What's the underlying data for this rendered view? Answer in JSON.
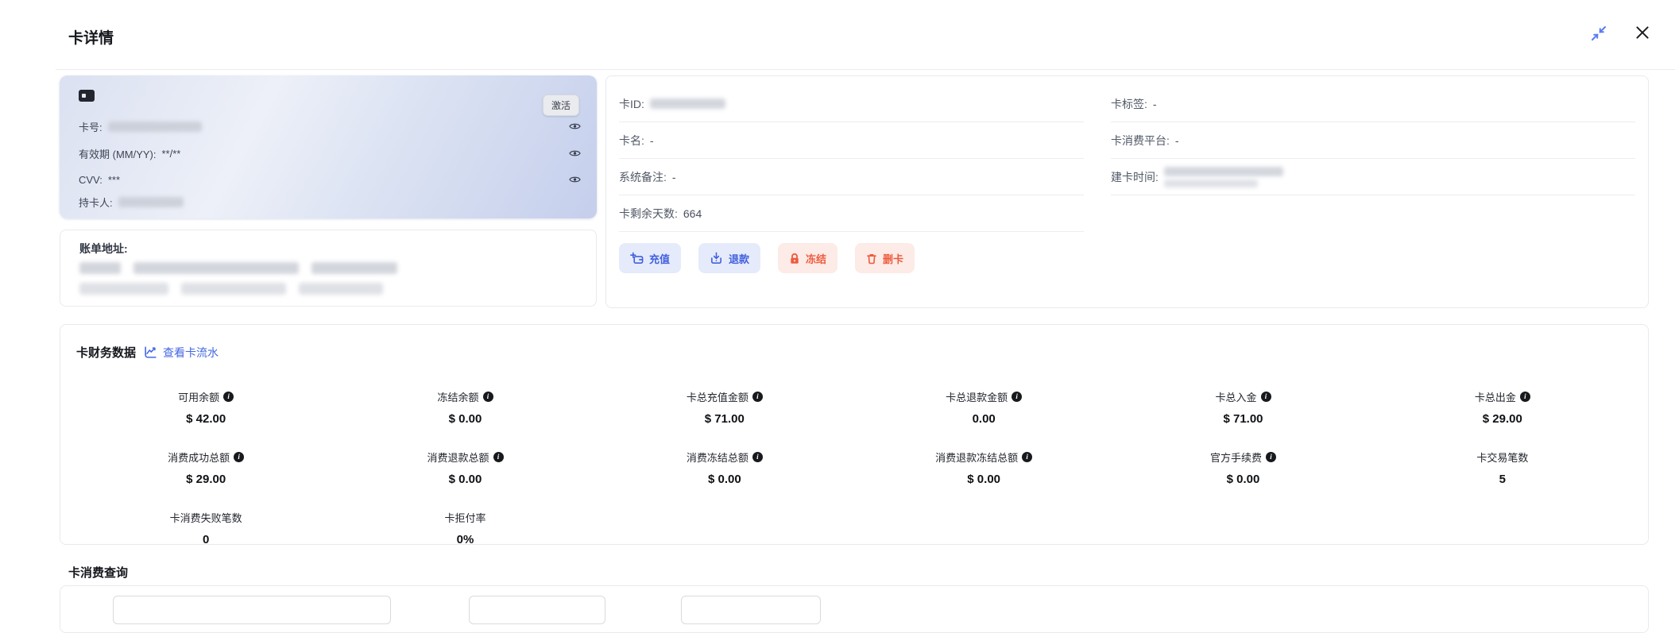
{
  "header": {
    "title": "卡详情"
  },
  "card": {
    "status_badge": "激活",
    "rows": [
      {
        "label": "卡号:",
        "masked": true
      },
      {
        "label": "有效期 (MM/YY):",
        "value": "**/**"
      },
      {
        "label": "CVV:",
        "value": "***"
      },
      {
        "label": "持卡人:",
        "masked": true
      }
    ]
  },
  "billing": {
    "label": "账单地址:"
  },
  "details": {
    "left": [
      {
        "label": "卡ID:",
        "masked": true
      },
      {
        "label": "卡名:",
        "value": "-"
      },
      {
        "label": "系统备注:",
        "value": "-"
      },
      {
        "label": "卡剩余天数:",
        "value": "664"
      }
    ],
    "right": [
      {
        "label": "卡标签:",
        "value": "-"
      },
      {
        "label": "卡消费平台:",
        "value": "-"
      },
      {
        "label": "建卡时间:",
        "masked": true
      }
    ]
  },
  "actions": {
    "recharge": "充值",
    "refund": "退款",
    "freeze": "冻结",
    "remove": "删卡"
  },
  "finance": {
    "title": "卡财务数据",
    "link": "查看卡流水",
    "metrics": [
      {
        "label": "可用余额",
        "value": "$ 42.00",
        "info": true
      },
      {
        "label": "冻结余额",
        "value": "$ 0.00",
        "info": true
      },
      {
        "label": "卡总充值金额",
        "value": "$ 71.00",
        "info": true
      },
      {
        "label": "卡总退款金额",
        "value": "0.00",
        "info": true
      },
      {
        "label": "卡总入金",
        "value": "$ 71.00",
        "info": true
      },
      {
        "label": "卡总出金",
        "value": "$ 29.00",
        "info": true
      },
      {
        "label": "消费成功总额",
        "value": "$ 29.00",
        "info": true
      },
      {
        "label": "消费退款总额",
        "value": "$ 0.00",
        "info": true
      },
      {
        "label": "消费冻结总额",
        "value": "$ 0.00",
        "info": true
      },
      {
        "label": "消费退款冻结总额",
        "value": "$ 0.00",
        "info": true
      },
      {
        "label": "官方手续费",
        "value": "$ 0.00",
        "info": true
      },
      {
        "label": "卡交易笔数",
        "value": "5",
        "info": false
      },
      {
        "label": "卡消费失败笔数",
        "value": "0",
        "info": false
      },
      {
        "label": "卡拒付率",
        "value": "0%",
        "info": false
      }
    ]
  },
  "query": {
    "title": "卡消费查询"
  },
  "colors": {
    "accent_blue": "#4160dd",
    "accent_red": "#ef5a3e",
    "link_blue": "#4467e2"
  }
}
